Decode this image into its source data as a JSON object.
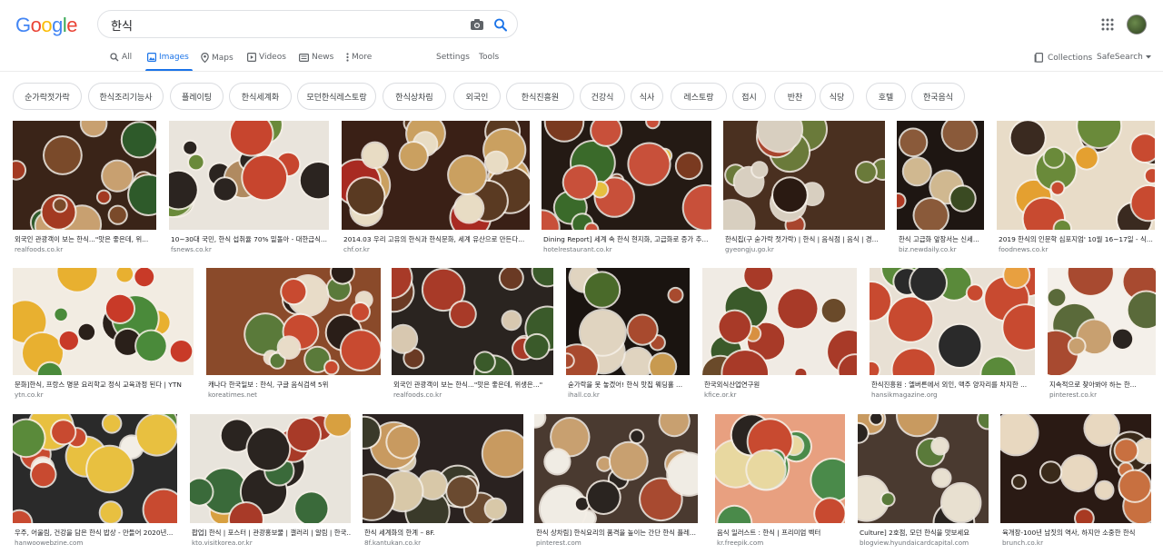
{
  "header": {
    "logo": "Google",
    "search_value": "한식"
  },
  "nav": {
    "all": "All",
    "images": "Images",
    "maps": "Maps",
    "videos": "Videos",
    "news": "News",
    "more": "More",
    "settings": "Settings",
    "tools": "Tools",
    "collections": "Collections",
    "safesearch": "SafeSearch"
  },
  "chips": [
    "순가락젓가락",
    "한식조리기능사",
    "플레이팅",
    "한식세계화",
    "모던한식레스토랑",
    "한식상차림",
    "외국인",
    "한식진흥원",
    "건강식",
    "식사",
    "레스토랑",
    "접시",
    "반찬",
    "식당",
    "호텔",
    "한국음식"
  ],
  "results": [
    {
      "caption": "외국인 관광객이 보는 한식...\"맛은 좋은데, 위...",
      "domain": "realfoods.co.kr",
      "palette": [
        "#3a2418",
        "#7a4a2a",
        "#c8a070",
        "#2e5a2a",
        "#a33a22"
      ]
    },
    {
      "caption": "10~30대 국민, 한식 섭취율 70% 밑돌아 - 대한급식...",
      "domain": "fsnews.co.kr",
      "palette": [
        "#e9e4dc",
        "#2b2420",
        "#c7452e",
        "#6a8a3a",
        "#b08a60"
      ]
    },
    {
      "caption": "2014.03 우리 고유의 한식과 한식문화, 세계 유산으로 만든다...",
      "domain": "chf.or.kr",
      "palette": [
        "#3a2016",
        "#e8dcc4",
        "#a82a22",
        "#caa060",
        "#5a3a22"
      ]
    },
    {
      "caption": "Dining Report] 세계 속 한식 현지화, 고급화로 증가 추...",
      "domain": "hotelrestaurant.co.kr",
      "palette": [
        "#241a14",
        "#c8503a",
        "#e6c040",
        "#3a6a2a",
        "#7a3a20"
      ]
    },
    {
      "caption": "한식집(구 숟가락 젓가락) | 한식 | 음식점 | 음식 | 경...",
      "domain": "gyeongju.go.kr",
      "palette": [
        "#4a3020",
        "#d8cfc0",
        "#a8452e",
        "#6a7a3a",
        "#2a1a12"
      ]
    },
    {
      "caption": "한식 고급화 앞장서는 신세...",
      "domain": "biz.newdaily.co.kr",
      "palette": [
        "#1e1612",
        "#8a5a3a",
        "#d0b890",
        "#b03a24",
        "#3a4a22"
      ]
    },
    {
      "caption": "2019 한식의 인문학 심포지엄' 10월 16~17일 - 식...",
      "domain": "foodnews.co.kr",
      "palette": [
        "#e8dcc8",
        "#3a2a20",
        "#e4a030",
        "#c84a30",
        "#6a8a3a"
      ]
    },
    {
      "caption": "문화]한식, 프랑스 명문 요리학교 정식 교육과정 된다 | YTN",
      "domain": "ytn.co.kr",
      "palette": [
        "#f2ece2",
        "#2a201a",
        "#e8b030",
        "#c83a28",
        "#4a8a3a"
      ]
    },
    {
      "caption": "캐나다 한국일보 : 한식, 구글 음식검색 5위",
      "domain": "koreatimes.net",
      "palette": [
        "#8a4a2a",
        "#e8dcc8",
        "#2a1e18",
        "#c84a30",
        "#5a7a3a"
      ]
    },
    {
      "caption": "외국인 관광객이 보는 한식...\"맛은 좋은데, 위생은...\"",
      "domain": "realfoods.co.kr",
      "palette": [
        "#2a2420",
        "#6a3a24",
        "#d8c8b0",
        "#a83a28",
        "#3a5a2a"
      ]
    },
    {
      "caption": "숟가락을 못 놓겠어! 한식 맛집 웨딩홀 ...",
      "domain": "ihall.co.kr",
      "palette": [
        "#1a1410",
        "#e0d4c0",
        "#a84a2e",
        "#c89a50",
        "#4a6a2a"
      ]
    },
    {
      "caption": "한국외식산업연구원",
      "domain": "kfice.or.kr",
      "palette": [
        "#f0ebe4",
        "#a83a28",
        "#d89040",
        "#3a5a2a",
        "#6a4a2a"
      ]
    },
    {
      "caption": "한식진흥원 : 엘버른에서 외인, 맥주 양자리를 차지한 ...",
      "domain": "hansikmagazine.org",
      "palette": [
        "#e8e0d4",
        "#c84a30",
        "#2a2a2a",
        "#e8a040",
        "#5a8a3a"
      ]
    },
    {
      "caption": "지속적으로 찾아봐야 하는 한...",
      "domain": "pinterest.co.kr",
      "palette": [
        "#f4f0ea",
        "#2a2420",
        "#c8a070",
        "#a84a30",
        "#5a6a3a"
      ]
    },
    {
      "caption": "우주, 어울림, 건강을 담은 한식 밥상 - 만들어 2020년...",
      "domain": "hanwoowebzine.com",
      "palette": [
        "#2a2a2a",
        "#f2eee6",
        "#e8c040",
        "#c84a30",
        "#5a8a3a"
      ]
    },
    {
      "caption": "팝업] 한식 | 포스터 | 관광홍보물 | 갤러리 | 알림 | 한국...",
      "domain": "kto.visitkorea.or.kr",
      "palette": [
        "#e8e4dc",
        "#a83a28",
        "#d8a040",
        "#2a2420",
        "#3a6a3a"
      ]
    },
    {
      "caption": "한식 세계화의 한계 – 8F.",
      "domain": "8f.kantukan.co.kr",
      "palette": [
        "#2a2220",
        "#d8c8a8",
        "#6a4a30",
        "#c89a60",
        "#3a3a2a"
      ]
    },
    {
      "caption": "한식 상차림] 한식요리의 품격을 높이는 간단 한식 플레...",
      "domain": "pinterest.com",
      "palette": [
        "#4a3a30",
        "#f0ece4",
        "#2a2420",
        "#c8a070",
        "#a84a30"
      ]
    },
    {
      "caption": "음식 일러스트 : 한식 | 프리미엄 벡터",
      "domain": "kr.freepik.com",
      "palette": [
        "#e8a080",
        "#2a2420",
        "#c84a30",
        "#e8d8a0",
        "#4a8a4a"
      ]
    },
    {
      "caption": "Culture] 2호점, 모던 한식을 맛보세요",
      "domain": "blogview.hyundaicardcapital.com",
      "palette": [
        "#4a3a30",
        "#e8e0d0",
        "#2a2420",
        "#c89a60",
        "#5a7a3a"
      ]
    },
    {
      "caption": "육개장-100년 남짓의 역사, 하지만 소중한 한식",
      "domain": "brunch.co.kr",
      "palette": [
        "#2a1a14",
        "#a83a22",
        "#e8d8c0",
        "#c87040",
        "#3a2a1a"
      ]
    }
  ]
}
